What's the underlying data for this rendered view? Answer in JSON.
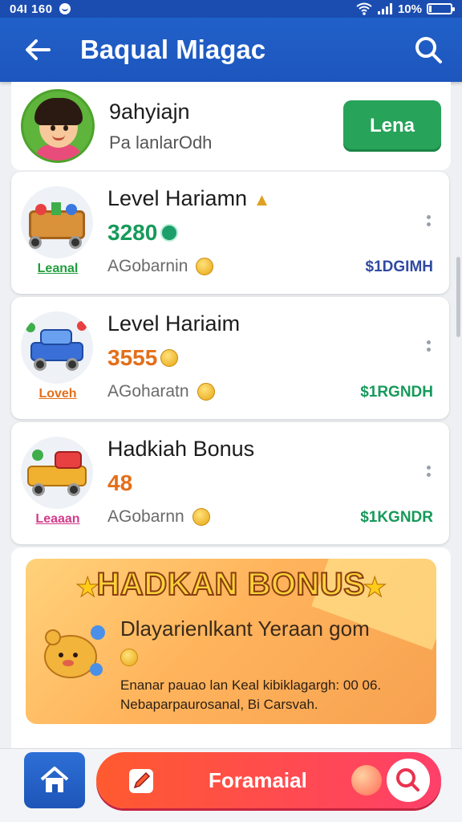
{
  "status_bar": {
    "time": "04I 160",
    "battery": "10%",
    "battery_level": 0.1
  },
  "app_bar": {
    "title": "Baqual Miagac"
  },
  "profile": {
    "name": "9ahyiajn",
    "subtitle": "Pa lanlarOdh",
    "button_label": "Lena"
  },
  "cards": [
    {
      "title": "Level Hariamn",
      "value": "3280",
      "value_color": "#169a5a",
      "desc": "AGobarnin",
      "code": "$1DGIMH",
      "code_color": "#2f4aa0",
      "thumb_label": "Leanal",
      "thumb_color": "#1e9e3a"
    },
    {
      "title": "Level Hariaim",
      "value": "3555",
      "value_color": "#e36f1a",
      "desc": "AGoharatn",
      "code": "$1RGNDH",
      "code_color": "#169a5a",
      "thumb_label": "Loveh",
      "thumb_color": "#e36f1a"
    },
    {
      "title": "Hadkiah Bonus",
      "value": "48",
      "value_color": "#e36f1a",
      "desc": "AGobarnn",
      "code": "$1KGNDR",
      "code_color": "#169a5a",
      "thumb_label": "Leaaan",
      "thumb_color": "#d13a8a"
    }
  ],
  "bonus": {
    "headline": "HADKAN BONUS",
    "subtitle": "Dlayarienlkant Yeraan gom",
    "fine_line1": "Enanar pauao lan Keal kibiklagargh: 00 06.",
    "fine_line2": "Nebaparpaurosanal, Bi Carsvah."
  },
  "bottom_bar": {
    "main_label": "Foramaial"
  }
}
